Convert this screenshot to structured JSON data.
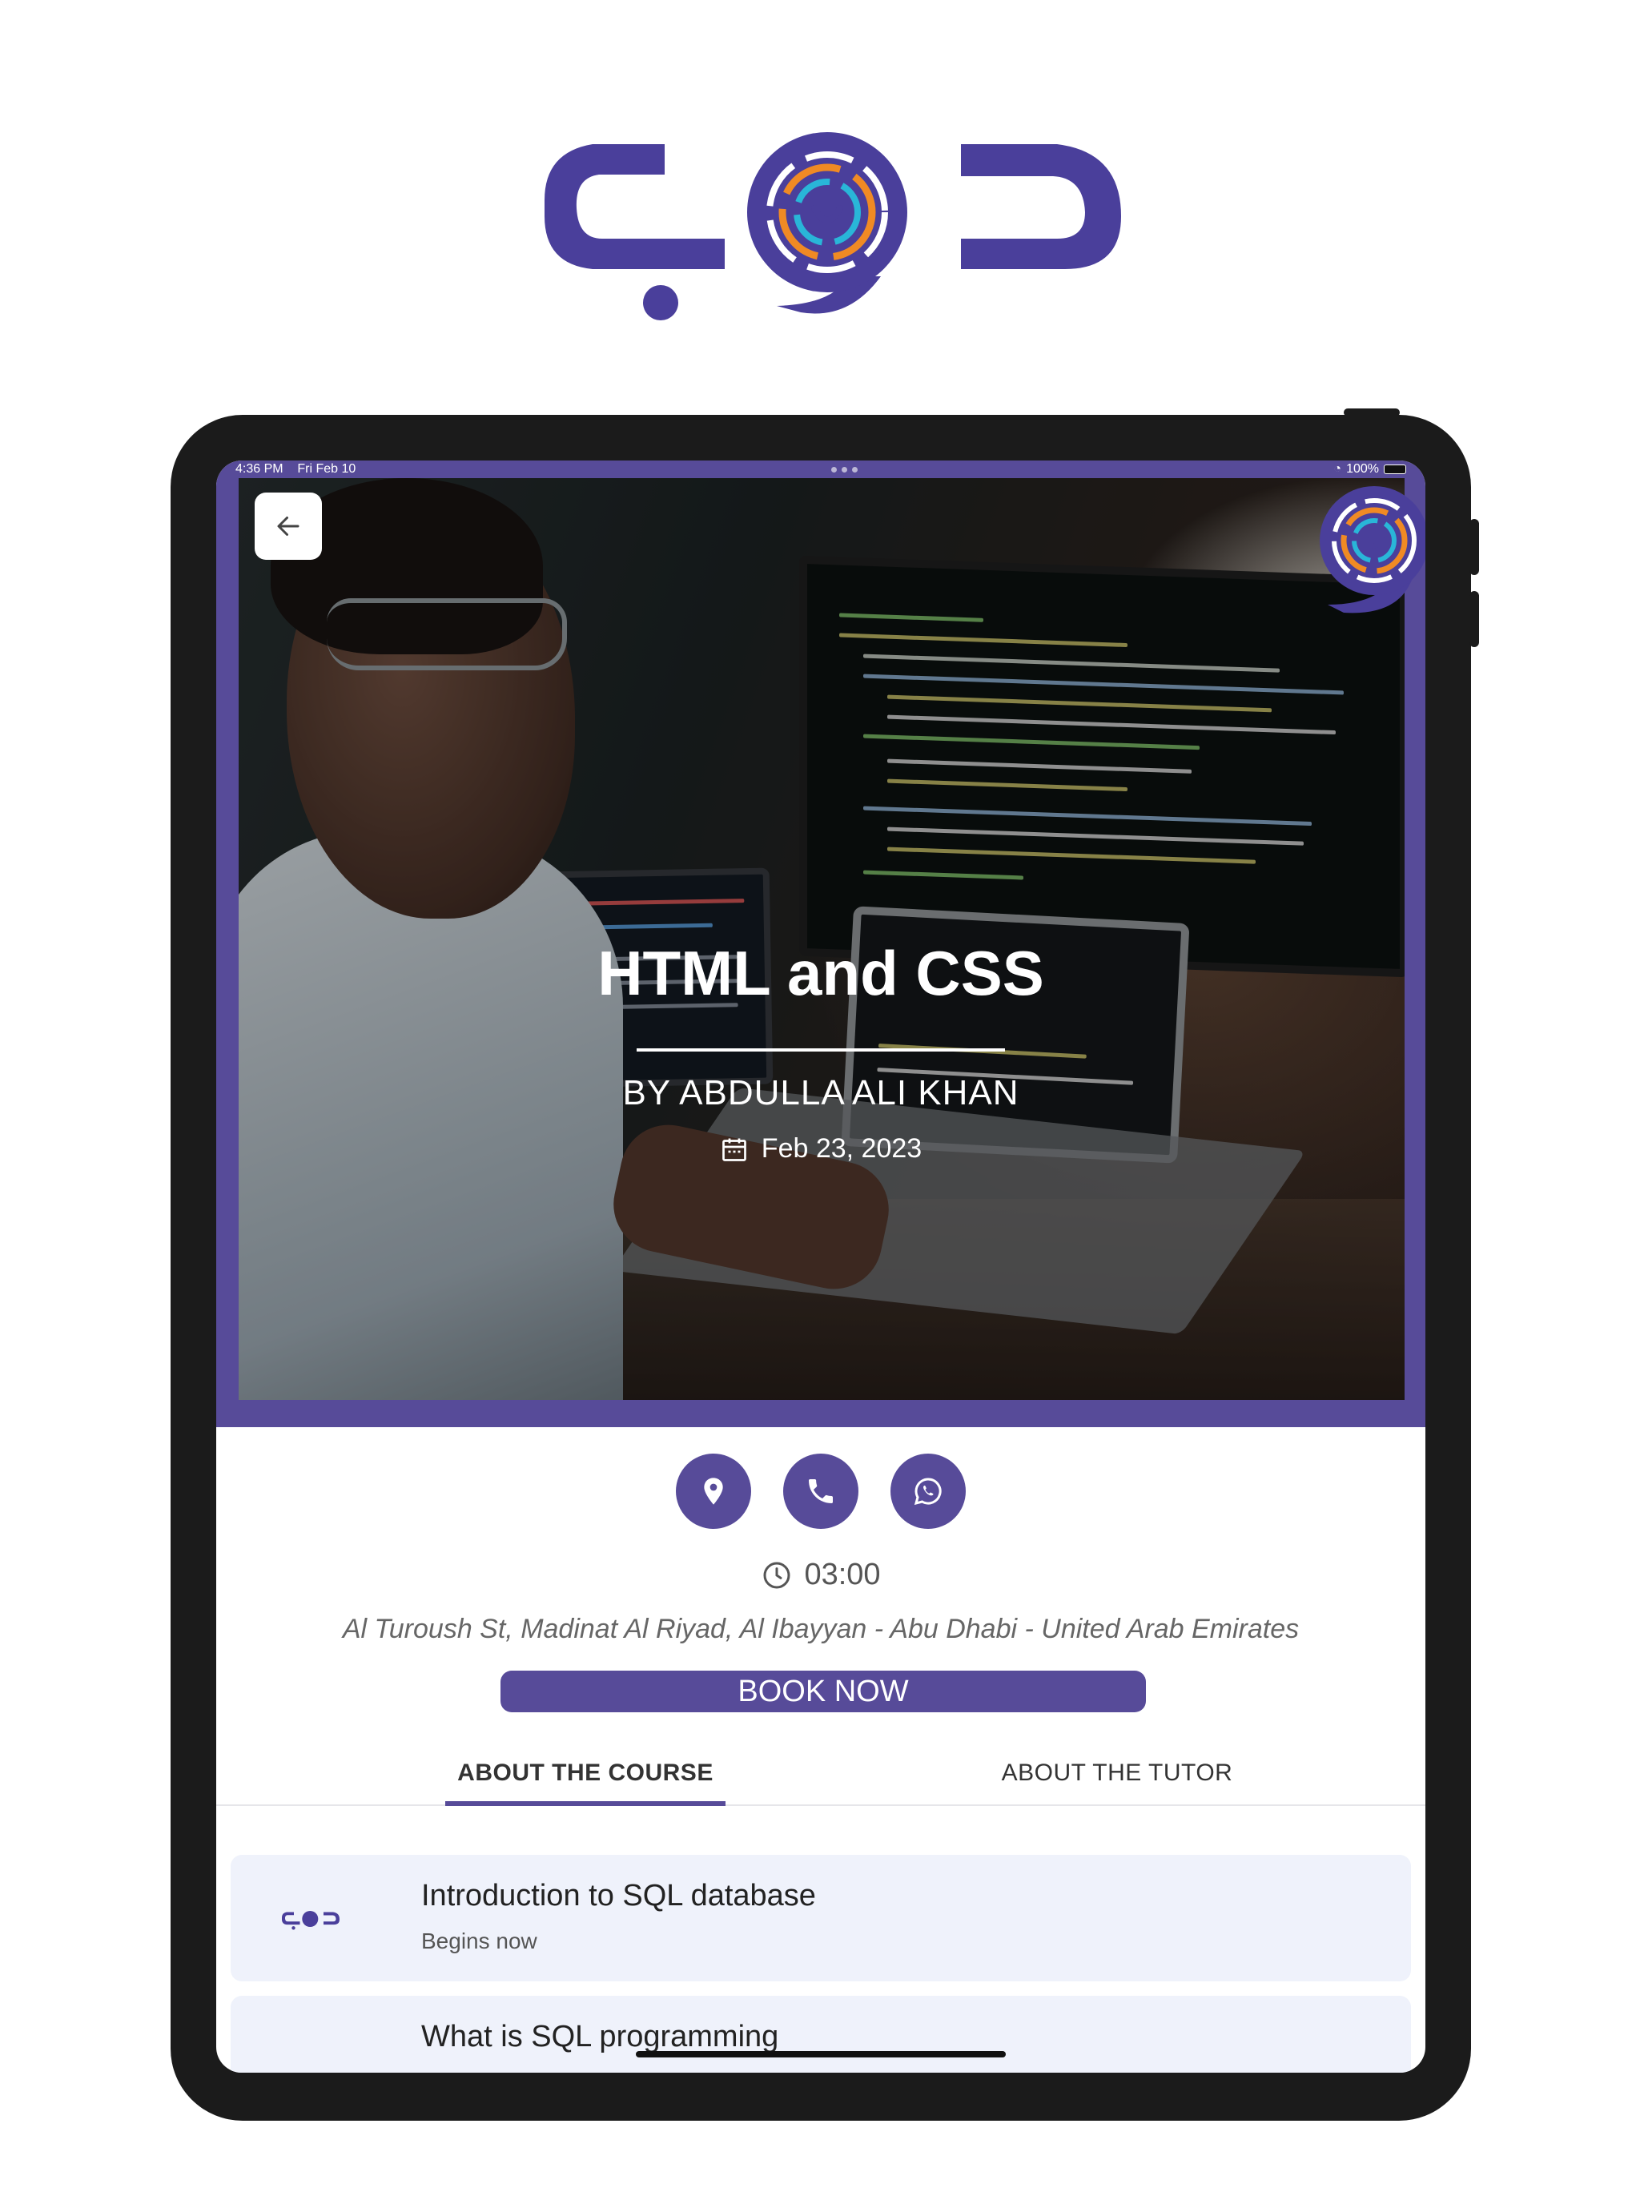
{
  "status_bar": {
    "time": "4:36 PM",
    "date": "Fri Feb 10",
    "battery": "100%"
  },
  "course": {
    "title": "HTML and CSS",
    "author": "BY ABDULLA ALI KHAN",
    "date": "Feb 23, 2023",
    "time": "03:00",
    "address": "Al Turoush St, Madinat Al Riyad, Al  Ibayyan - Abu Dhabi - United Arab Emirates"
  },
  "actions": {
    "book_label": "BOOK NOW"
  },
  "tabs": [
    {
      "label": "ABOUT THE COURSE",
      "active": true
    },
    {
      "label": "ABOUT THE TUTOR",
      "active": false
    }
  ],
  "lessons": [
    {
      "title": "Introduction to SQL database",
      "subtitle": "Begins now"
    },
    {
      "title": "What is SQL programming",
      "subtitle": ""
    }
  ],
  "icons": {
    "back": "arrow-left-icon",
    "location": "map-pin-icon",
    "phone": "phone-icon",
    "whatsapp": "whatsapp-icon",
    "calendar": "calendar-icon",
    "clock": "clock-icon"
  },
  "colors": {
    "brand": "#574b99",
    "brand_orange": "#f08a24",
    "brand_cyan": "#29b6d8",
    "lesson_bg": "#eff2fb"
  }
}
